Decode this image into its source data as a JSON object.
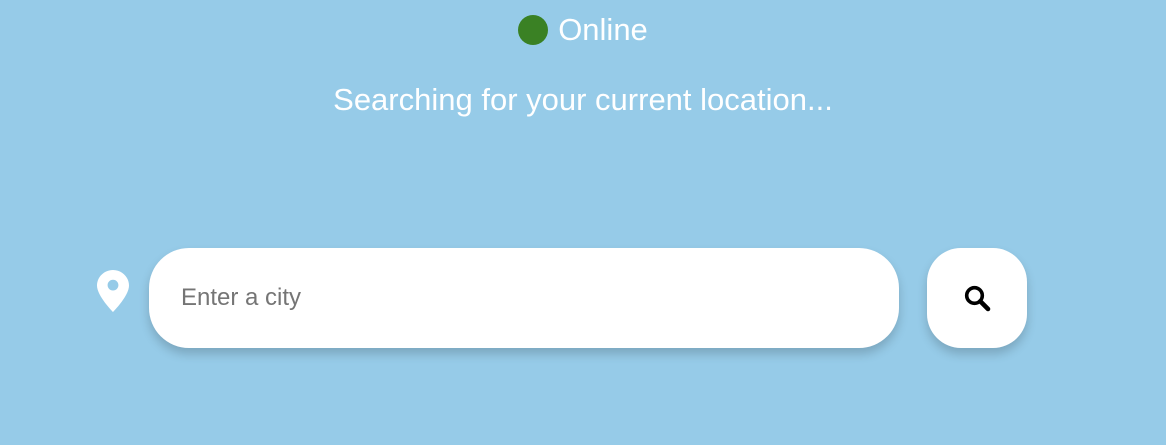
{
  "status": {
    "label": "Online",
    "dot_color": "#3a8124"
  },
  "message": "Searching for your current location...",
  "search": {
    "placeholder": "Enter a city",
    "value": "",
    "button_icon": "search-icon",
    "location_icon": "location-pin-icon"
  },
  "colors": {
    "background": "#96cbe8",
    "text": "#ffffff",
    "field_background": "#ffffff"
  }
}
